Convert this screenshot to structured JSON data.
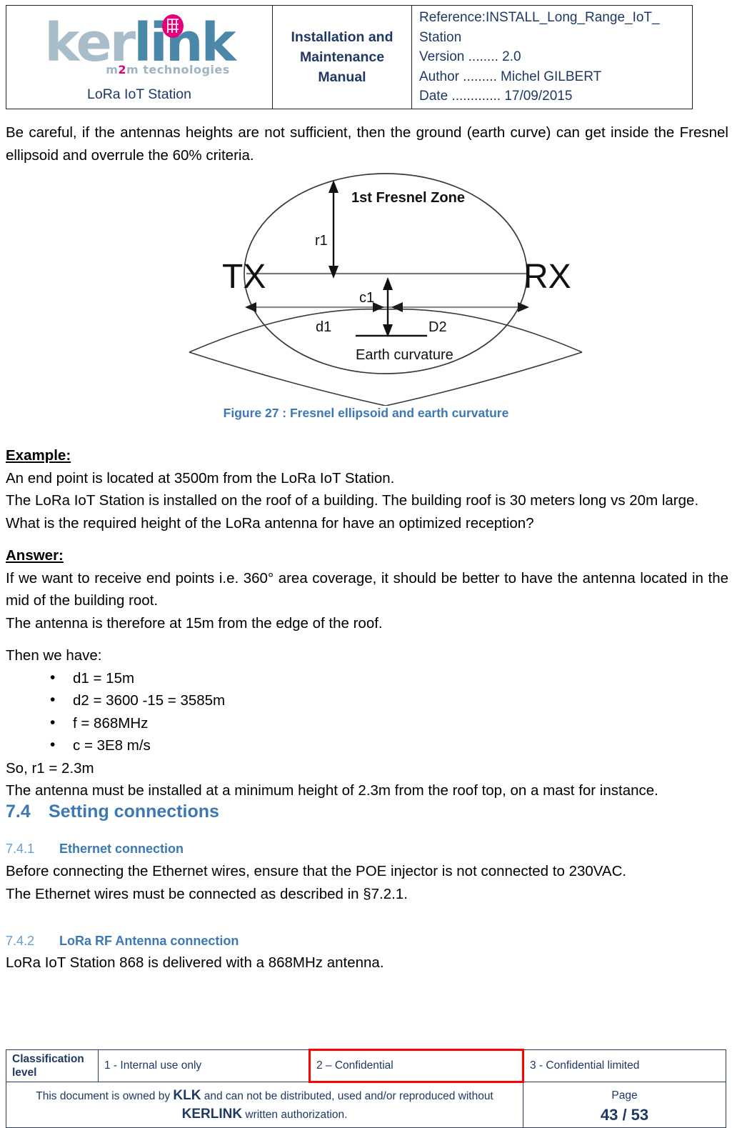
{
  "header": {
    "logo": {
      "word_part1": "ker",
      "word_part2": "link",
      "tagline_pre": "m",
      "tagline_two": "2",
      "tagline_post": "m technologies"
    },
    "product": "LoRa IoT Station",
    "doc_title": "Installation and Maintenance Manual",
    "meta": {
      "reference": "Reference:INSTALL_Long_Range_IoT_",
      "reference_cont": "Station",
      "version": "Version ........ 2.0",
      "author": "Author ......... Michel GILBERT",
      "date": "Date ............. 17/09/2015"
    }
  },
  "body": {
    "intro": "Be careful, if the antennas heights are not sufficient, then the ground (earth curve) can get inside the Fresnel ellipsoid and overrule the 60% criteria.",
    "figure": {
      "caption": "Figure 27 : Fresnel ellipsoid and earth curvature",
      "label_zone": "1st Fresnel Zone",
      "label_r1": "r1",
      "label_tx": "TX",
      "label_rx": "RX",
      "label_d1": "d1",
      "label_c1": "c1",
      "label_d2": "D2",
      "label_earth": "Earth curvature",
      "caption_color": "#3c78b4"
    },
    "example": {
      "title": "Example:",
      "line1": "An end point is located at 3500m from the LoRa IoT Station.",
      "line2": "The LoRa IoT Station is installed on the roof of a building. The building roof is 30 meters long vs 20m large.",
      "line3": "What is the required height of the LoRa antenna for have an optimized reception?"
    },
    "answer": {
      "title": "Answer:",
      "para": "If we want to receive end points i.e. 360° area coverage, it should be better to have the antenna located in the mid of the building root.",
      "line2": "The antenna is therefore at 15m from the edge of the roof."
    },
    "calc": {
      "intro": "Then we have:",
      "items": [
        "d1 = 15m",
        "d2 = 3600 -15 = 3585m",
        "f = 868MHz",
        "c = 3E8 m/s"
      ],
      "result": "So, r1 = 2.3m",
      "conclusion": "The antenna must be installed at a minimum height of 2.3m from the roof top, on a mast for instance."
    },
    "section_74": {
      "number": "7.4",
      "title": "Setting connections"
    },
    "section_741": {
      "number": "7.4.1",
      "title": "Ethernet connection",
      "line1": "Before connecting the Ethernet wires, ensure that the POE injector is not connected to 230VAC.",
      "line2": "The Ethernet wires must be connected as described in §7.2.1."
    },
    "section_742": {
      "number": "7.4.2",
      "title": "LoRa RF Antenna connection",
      "line1": "LoRa IoT Station 868 is delivered with a 868MHz antenna."
    }
  },
  "footer": {
    "classification_label": "Classification level",
    "level1": "1 - Internal use only",
    "level2": "2 – Confidential",
    "level3": "3 - Confidential limited",
    "level2_highlight_color": "#ff0000",
    "notice_pre": "This document is owned by ",
    "notice_klk": "KLK",
    "notice_mid": " and can not be distributed, used and/or reproduced  without ",
    "notice_kerlink": "KERLINK",
    "notice_post": " written authorization.",
    "page_label": "Page",
    "page_number": "43 / 53"
  }
}
